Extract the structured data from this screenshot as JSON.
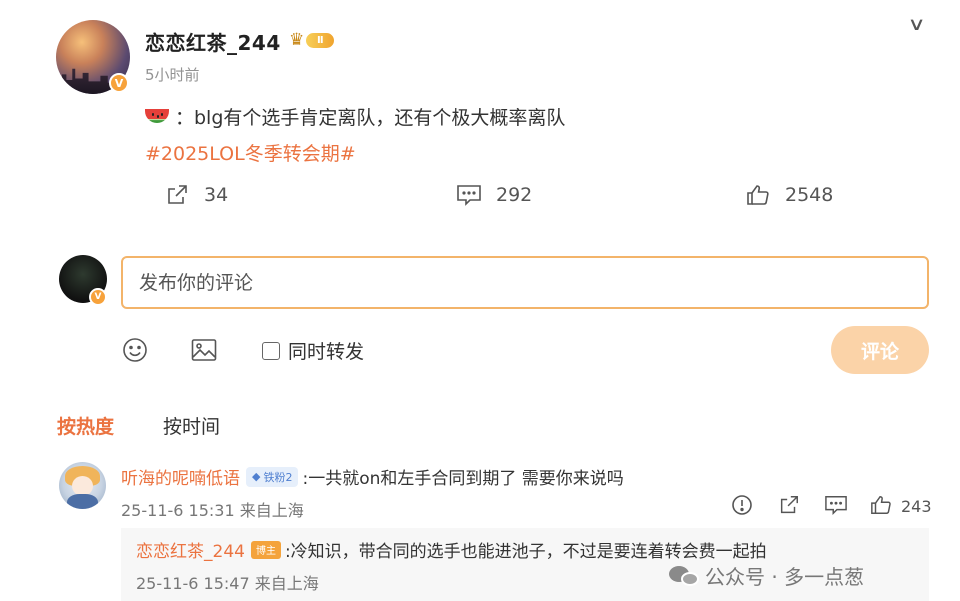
{
  "post": {
    "author": "恋恋红茶_244",
    "level_badge": "Ⅱ",
    "time": "5小时前",
    "text": "：blg有个选手肯定离队，还有个极大概率离队",
    "hashtag": "#2025LOL冬季转会期#",
    "share_count": "34",
    "comment_count": "292",
    "like_count": "2548",
    "verified_badge": "V"
  },
  "composer": {
    "placeholder": "发布你的评论",
    "also_repost_label": "同时转发",
    "submit_label": "评论"
  },
  "sort": {
    "hot_label": "按热度",
    "time_label": "按时间"
  },
  "comments": [
    {
      "author": "听海的呢喃低语",
      "fan_badge": "铁粉2",
      "text": ":一共就on和左手合同到期了 需要你来说吗",
      "meta": "25-11-6 15:31 来自上海",
      "like_count": "243",
      "reply": {
        "author": "恋恋红茶_244",
        "author_badge": "博主",
        "text": ":冷知识，带合同的选手也能进池子，不过是要连着转会费一起拍",
        "meta": "25-11-6 15:47 来自上海"
      }
    }
  ],
  "watermark": {
    "text": "公众号 · 多一点葱"
  },
  "colors": {
    "accent": "#eb7340",
    "input_border": "#f3b46a",
    "submit_bg": "#fbd3a8"
  }
}
